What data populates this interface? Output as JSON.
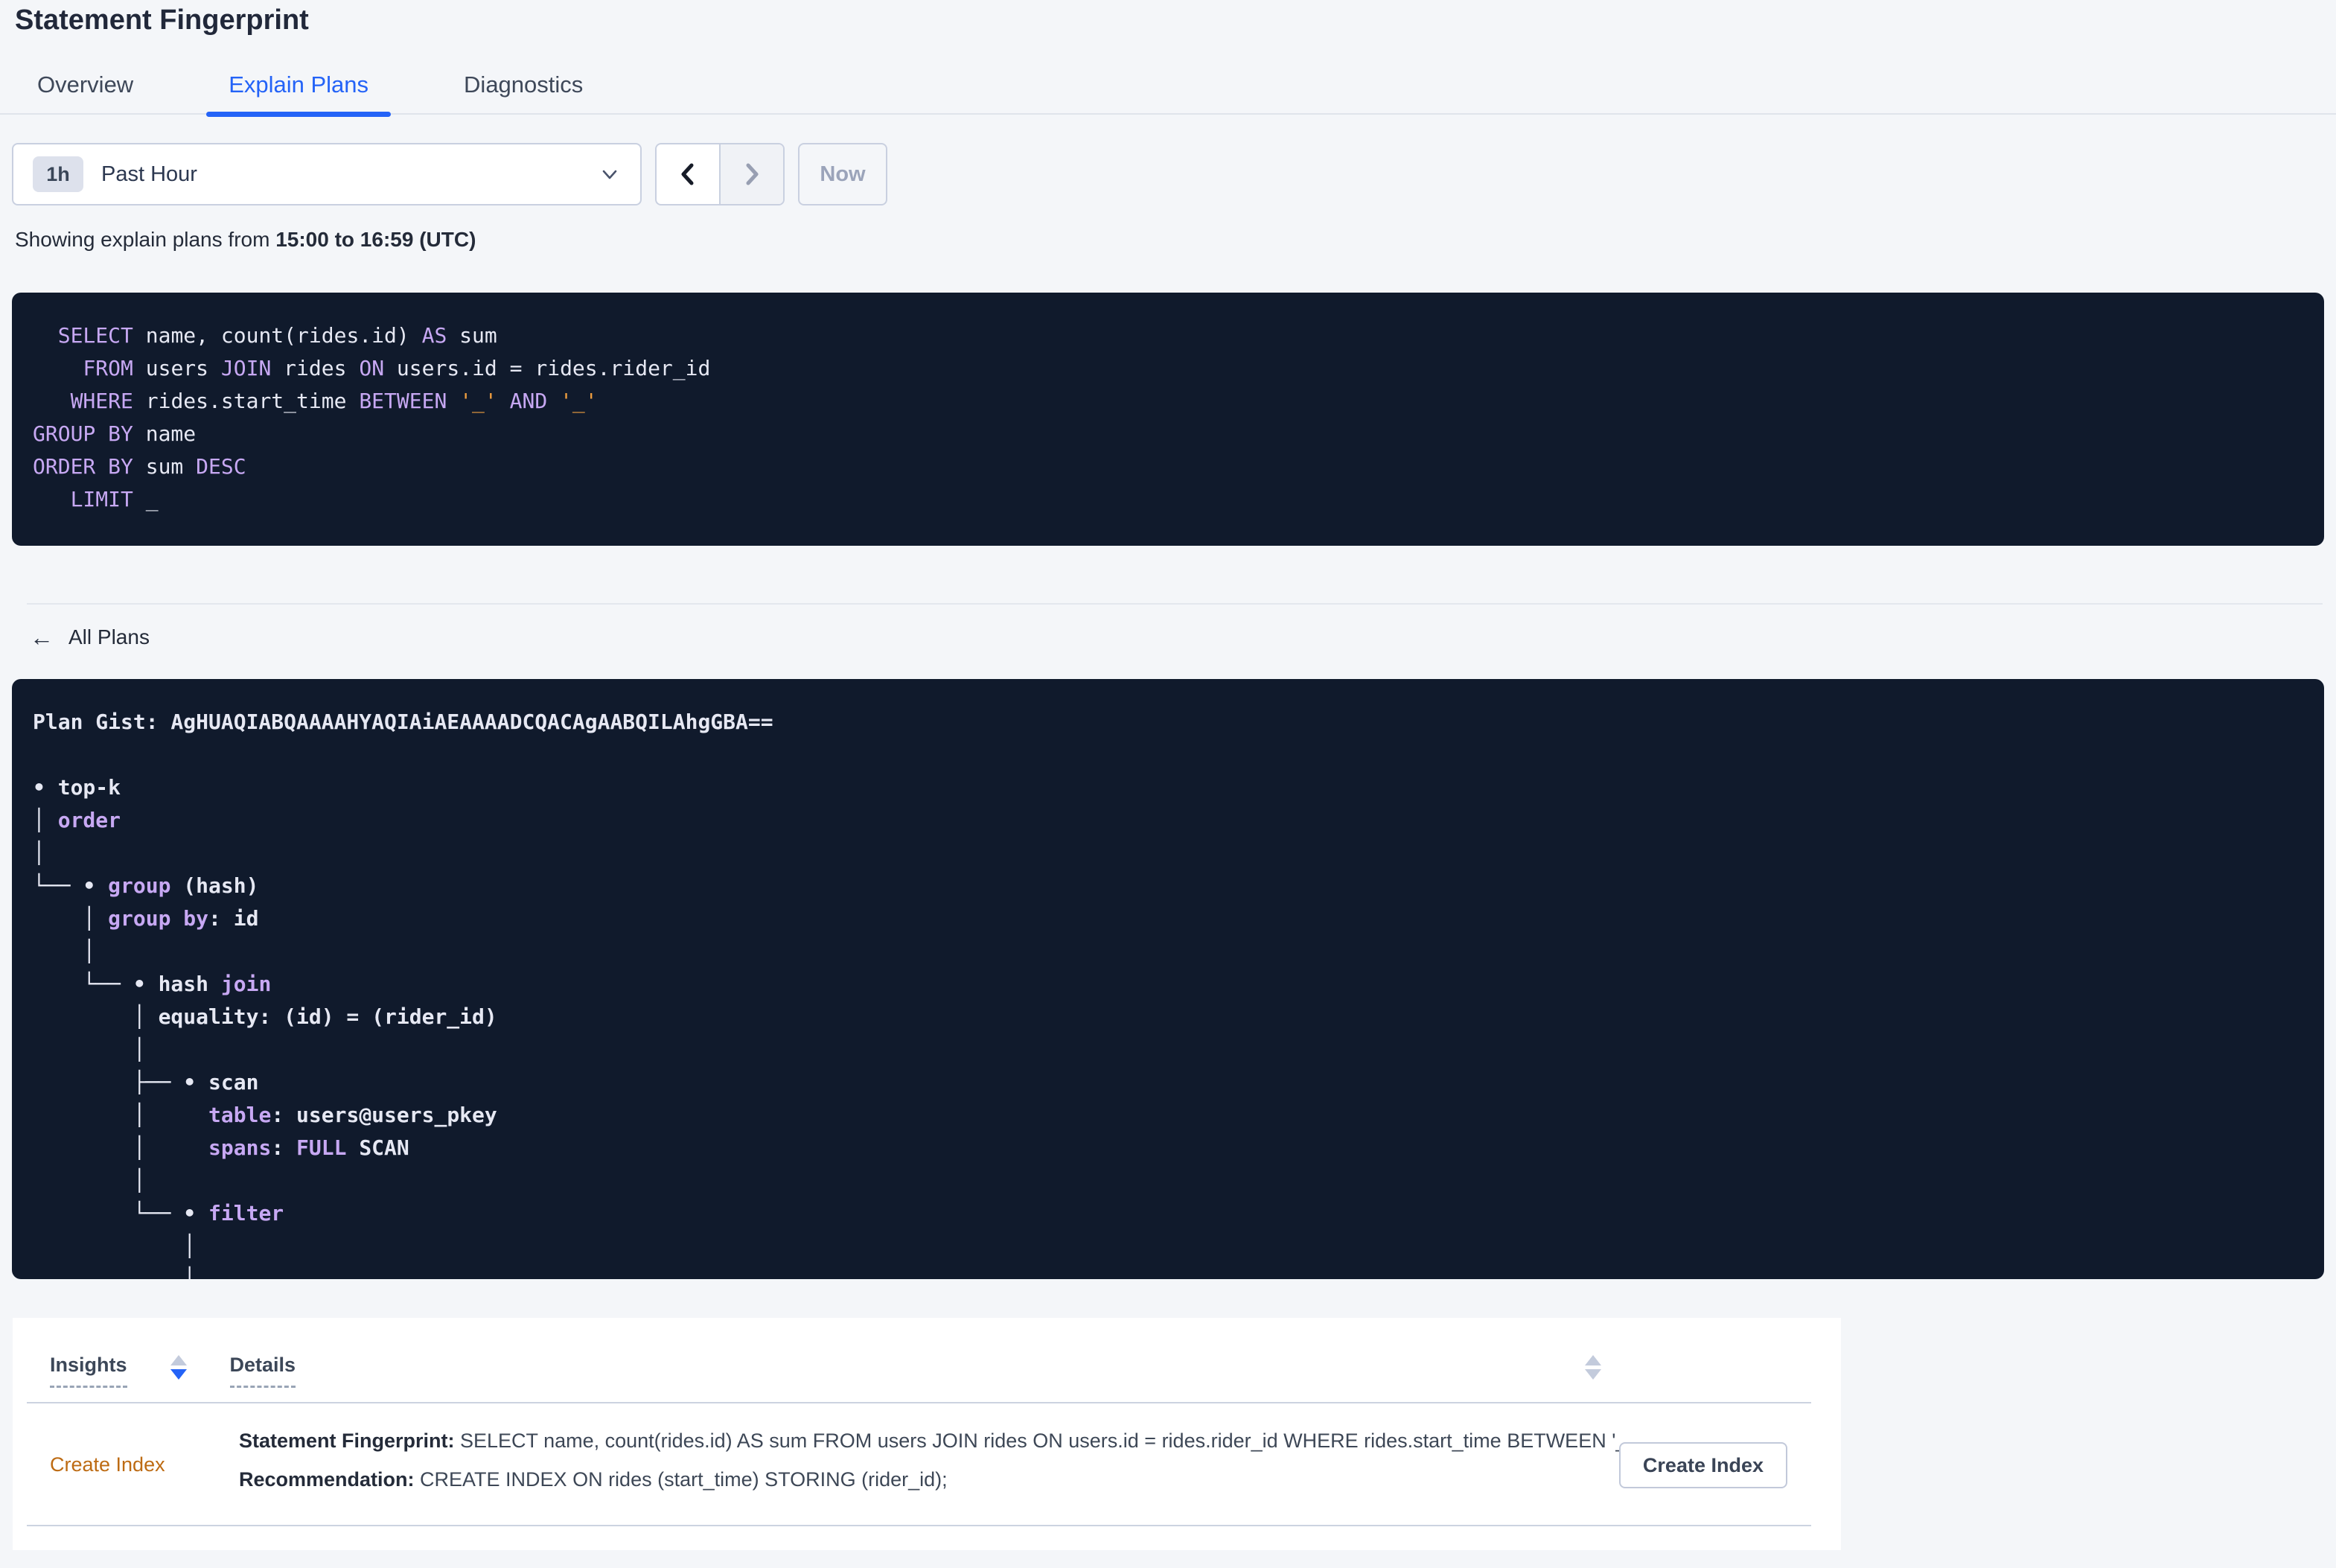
{
  "header": {
    "title": "Statement Fingerprint"
  },
  "tabs": [
    {
      "label": "Overview",
      "active": false
    },
    {
      "label": "Explain Plans",
      "active": true
    },
    {
      "label": "Diagnostics",
      "active": false
    }
  ],
  "controls": {
    "interval_badge": "1h",
    "interval_label": "Past Hour",
    "now_label": "Now"
  },
  "caption": {
    "prefix": "Showing explain plans from ",
    "range": "15:00 to 16:59 (UTC)"
  },
  "sql": {
    "lines": [
      [
        {
          "c": "t",
          "t": "  "
        },
        {
          "c": "k",
          "t": "SELECT"
        },
        {
          "c": "t",
          "t": " name, count(rides.id) "
        },
        {
          "c": "k",
          "t": "AS"
        },
        {
          "c": "t",
          "t": " sum"
        }
      ],
      [
        {
          "c": "t",
          "t": "    "
        },
        {
          "c": "k",
          "t": "FROM"
        },
        {
          "c": "t",
          "t": " users "
        },
        {
          "c": "k",
          "t": "JOIN"
        },
        {
          "c": "t",
          "t": " rides "
        },
        {
          "c": "k",
          "t": "ON"
        },
        {
          "c": "t",
          "t": " users.id = rides.rider_id"
        }
      ],
      [
        {
          "c": "t",
          "t": "   "
        },
        {
          "c": "k",
          "t": "WHERE"
        },
        {
          "c": "t",
          "t": " rides.start_time "
        },
        {
          "c": "k",
          "t": "BETWEEN"
        },
        {
          "c": "t",
          "t": " "
        },
        {
          "c": "p",
          "t": "'_'"
        },
        {
          "c": "t",
          "t": " "
        },
        {
          "c": "k",
          "t": "AND"
        },
        {
          "c": "t",
          "t": " "
        },
        {
          "c": "p",
          "t": "'_'"
        }
      ],
      [
        {
          "c": "k",
          "t": "GROUP BY"
        },
        {
          "c": "t",
          "t": " name"
        }
      ],
      [
        {
          "c": "k",
          "t": "ORDER BY"
        },
        {
          "c": "t",
          "t": " sum "
        },
        {
          "c": "k",
          "t": "DESC"
        }
      ],
      [
        {
          "c": "t",
          "t": "   "
        },
        {
          "c": "k",
          "t": "LIMIT"
        },
        {
          "c": "t",
          "t": " _"
        }
      ]
    ]
  },
  "back_link": {
    "arrow": "←",
    "label": "All Plans"
  },
  "plan": {
    "lines": [
      [
        {
          "c": "t",
          "t": "Plan Gist: AgHUAQIABQAAAAHYAQIAiAEAAAADCQACAgAABQILAhgGBA=="
        }
      ],
      [],
      [
        {
          "c": "t",
          "t": "• top-k"
        }
      ],
      [
        {
          "c": "t",
          "t": "│ "
        },
        {
          "c": "k",
          "t": "order"
        }
      ],
      [
        {
          "c": "t",
          "t": "│"
        }
      ],
      [
        {
          "c": "t",
          "t": "└── • "
        },
        {
          "c": "k",
          "t": "group"
        },
        {
          "c": "t",
          "t": " (hash)"
        }
      ],
      [
        {
          "c": "t",
          "t": "    │ "
        },
        {
          "c": "k",
          "t": "group by"
        },
        {
          "c": "t",
          "t": ": id"
        }
      ],
      [
        {
          "c": "t",
          "t": "    │"
        }
      ],
      [
        {
          "c": "t",
          "t": "    └── • hash "
        },
        {
          "c": "k",
          "t": "join"
        }
      ],
      [
        {
          "c": "t",
          "t": "        │ equality: (id) = (rider_id)"
        }
      ],
      [
        {
          "c": "t",
          "t": "        │"
        }
      ],
      [
        {
          "c": "t",
          "t": "        ├── • scan"
        }
      ],
      [
        {
          "c": "t",
          "t": "        │     "
        },
        {
          "c": "k",
          "t": "table"
        },
        {
          "c": "t",
          "t": ": users@users_pkey"
        }
      ],
      [
        {
          "c": "t",
          "t": "        │     "
        },
        {
          "c": "k",
          "t": "spans"
        },
        {
          "c": "t",
          "t": ": "
        },
        {
          "c": "k",
          "t": "FULL"
        },
        {
          "c": "t",
          "t": " SCAN"
        }
      ],
      [
        {
          "c": "t",
          "t": "        │"
        }
      ],
      [
        {
          "c": "t",
          "t": "        └── • "
        },
        {
          "c": "k",
          "t": "filter"
        }
      ],
      [
        {
          "c": "t",
          "t": "            │"
        }
      ],
      [
        {
          "c": "t",
          "t": "            │"
        }
      ]
    ]
  },
  "insights": {
    "columns": [
      {
        "label": "Insights"
      },
      {
        "label": "Details"
      }
    ],
    "rows": [
      {
        "insight": "Create Index",
        "details": [
          {
            "label": "Statement Fingerprint:",
            "text": " SELECT name, count(rides.id) AS sum FROM users JOIN rides ON users.id = rides.rider_id WHERE rides.start_time BETWEEN '_…"
          },
          {
            "label": "Recommendation:",
            "text": " CREATE INDEX ON rides (start_time) STORING (rider_id);"
          }
        ],
        "action": "Create Index"
      }
    ]
  },
  "colors": {
    "accent_blue": "#2463f7",
    "keyword_purple": "#c7a8f3",
    "placeholder_orange": "#ee9d3f",
    "insight_orange": "#bd6b13",
    "panel_bg": "#101a2c"
  }
}
